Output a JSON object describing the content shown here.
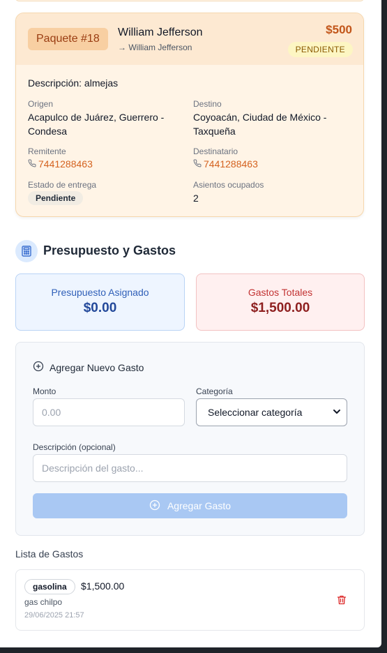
{
  "package": {
    "badge": "Paquete #18",
    "name": "William Jefferson",
    "recipient_line": "→ William Jefferson",
    "price": "$500",
    "status": "PENDIENTE",
    "description": "Descripción: almejas",
    "origin_label": "Origen",
    "origin": "Acapulco de Juárez, Guerrero - Condesa",
    "destination_label": "Destino",
    "destination": "Coyoacán, Ciudad de México - Taxqueña",
    "sender_label": "Remitente",
    "sender_phone": "7441288463",
    "recipient_label": "Destinatario",
    "recipient_phone": "7441288463",
    "delivery_label": "Estado de entrega",
    "delivery_status": "Pendiente",
    "seats_label": "Asientos ocupados",
    "seats": "2"
  },
  "budget": {
    "title": "Presupuesto y Gastos",
    "assigned_label": "Presupuesto Asignado",
    "assigned_value": "$0.00",
    "total_label": "Gastos Totales",
    "total_value": "$1,500.00"
  },
  "form": {
    "heading": "Agregar Nuevo Gasto",
    "amount_label": "Monto",
    "amount_placeholder": "0.00",
    "category_label": "Categoría",
    "category_selected": "Seleccionar categoría",
    "description_label": "Descripción (opcional)",
    "description_placeholder": "Descripción del gasto...",
    "submit_label": "Agregar Gasto"
  },
  "expenses": {
    "title": "Lista de Gastos",
    "items": [
      {
        "category": "gasolina",
        "amount": "$1,500.00",
        "description": "gas chilpo",
        "date": "29/06/2025 21:57"
      }
    ]
  },
  "colors": {
    "accent_orange": "#d4621f",
    "primary_blue": "#2f5fb8",
    "danger_red": "#c23232"
  }
}
